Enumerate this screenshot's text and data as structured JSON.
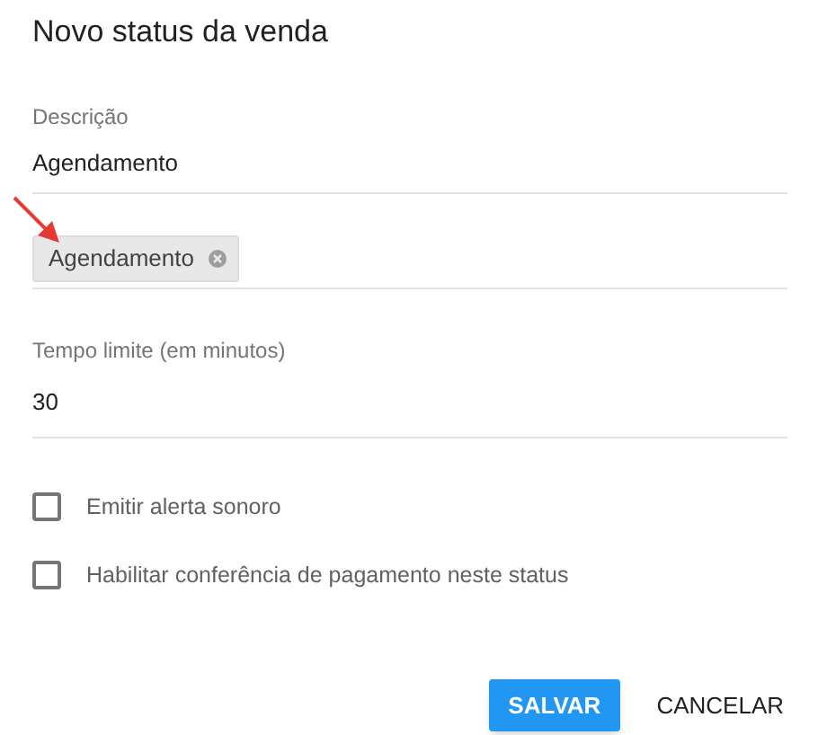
{
  "dialog": {
    "title": "Novo status da venda"
  },
  "description_field": {
    "label": "Descrição",
    "value": "Agendamento"
  },
  "chips": [
    {
      "label": "Agendamento"
    }
  ],
  "time_field": {
    "label": "Tempo limite (em minutos)",
    "value": "30"
  },
  "checkboxes": [
    {
      "label": "Emitir alerta sonoro",
      "checked": false
    },
    {
      "label": "Habilitar conferência de pagamento neste status",
      "checked": false
    }
  ],
  "buttons": [
    {
      "label": "SALVAR",
      "kind": "primary"
    },
    {
      "label": "CANCELAR",
      "kind": "text"
    }
  ]
}
